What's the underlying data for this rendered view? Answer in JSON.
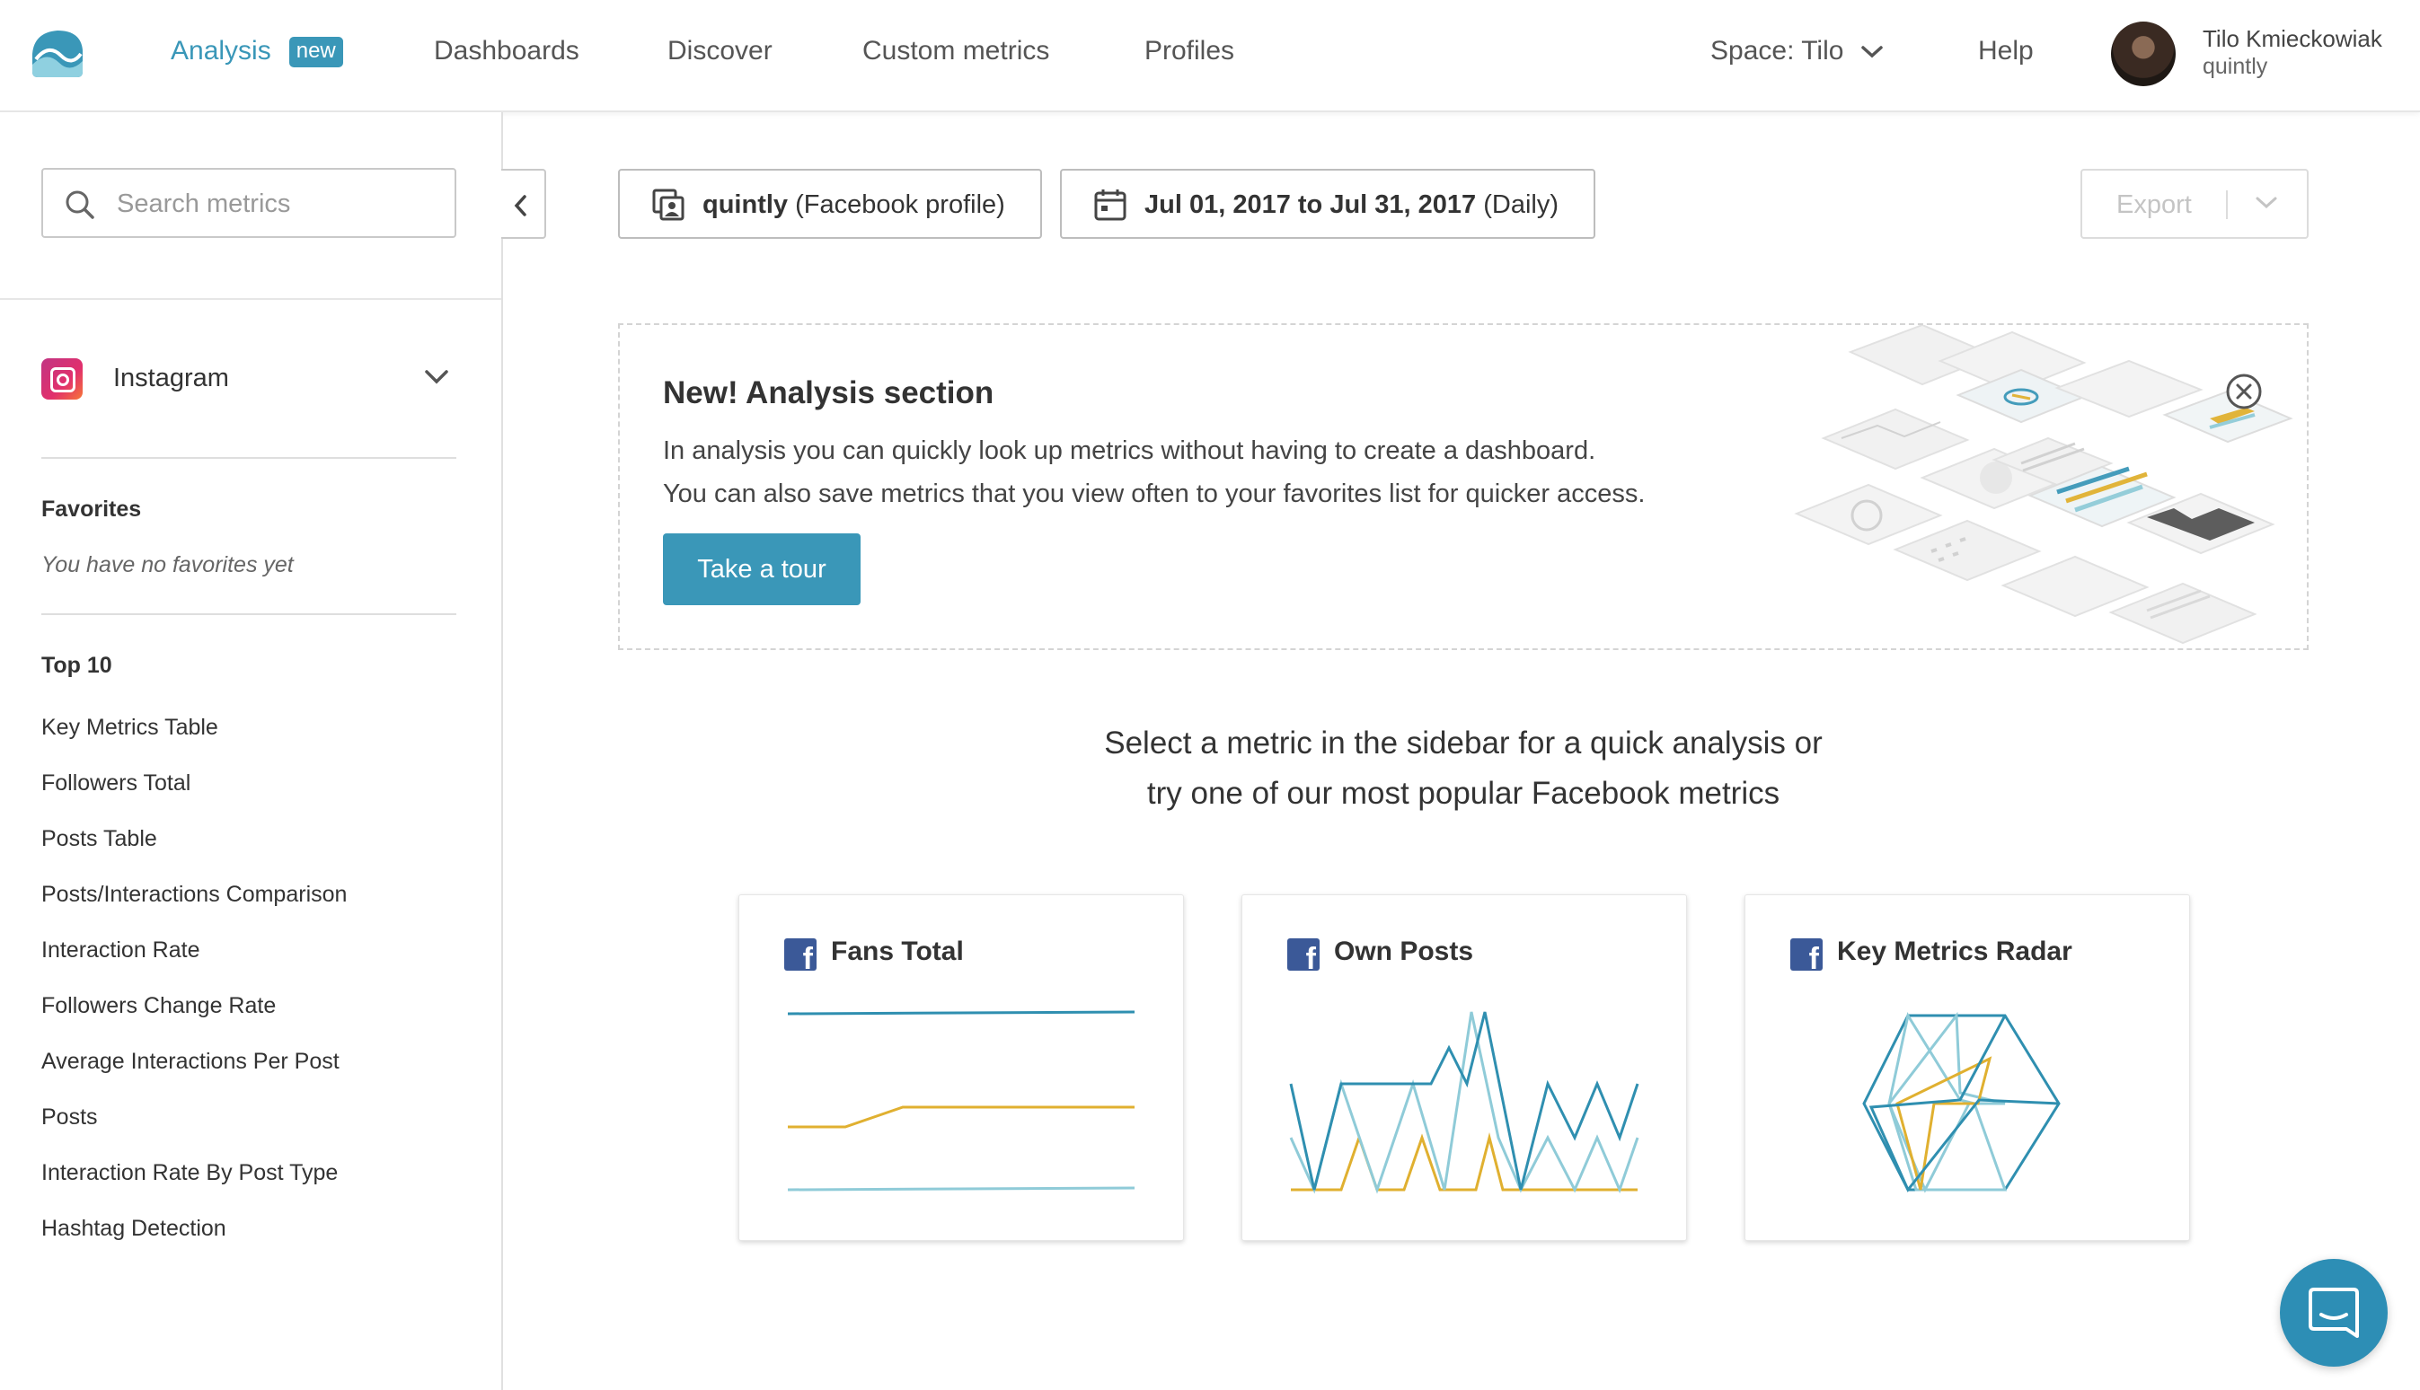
{
  "nav": {
    "items": [
      {
        "label": "Analysis",
        "badge": "new",
        "active": true
      },
      {
        "label": "Dashboards"
      },
      {
        "label": "Discover"
      },
      {
        "label": "Custom metrics"
      },
      {
        "label": "Profiles"
      }
    ],
    "space_label": "Space: Tilo",
    "help_label": "Help",
    "user": {
      "name": "Tilo Kmieckowiak",
      "org": "quintly"
    }
  },
  "sidebar": {
    "search_placeholder": "Search metrics",
    "network": "Instagram",
    "favorites_heading": "Favorites",
    "favorites_empty": "You have no favorites yet",
    "top10_heading": "Top 10",
    "top10": [
      "Key Metrics Table",
      "Followers Total",
      "Posts Table",
      "Posts/Interactions Comparison",
      "Interaction Rate",
      "Followers Change Rate",
      "Average Interactions Per Post",
      "Posts",
      "Interaction Rate By Post Type",
      "Hashtag Detection"
    ]
  },
  "toolbar": {
    "profile_name": "quintly",
    "profile_type": "(Facebook profile)",
    "date_range": "Jul 01, 2017 to Jul 31, 2017",
    "date_interval": "(Daily)",
    "export_label": "Export"
  },
  "banner": {
    "title": "New! Analysis section",
    "line1": "In analysis you can quickly look up metrics without having to create a dashboard.",
    "line2": "You can also save metrics that you view often to your favorites list for quicker access.",
    "tour_label": "Take a tour"
  },
  "prompt": {
    "line1": "Select a metric in the sidebar for a quick analysis or",
    "line2": "try one of our most popular Facebook metrics"
  },
  "cards": [
    {
      "title": "Fans Total"
    },
    {
      "title": "Own Posts"
    },
    {
      "title": "Key Metrics Radar"
    }
  ],
  "colors": {
    "accent": "#3a97b8",
    "facebook": "#3b5998",
    "chart_teal": "#2f8fb0",
    "chart_light": "#8fcbd8",
    "chart_yellow": "#e0b030"
  }
}
